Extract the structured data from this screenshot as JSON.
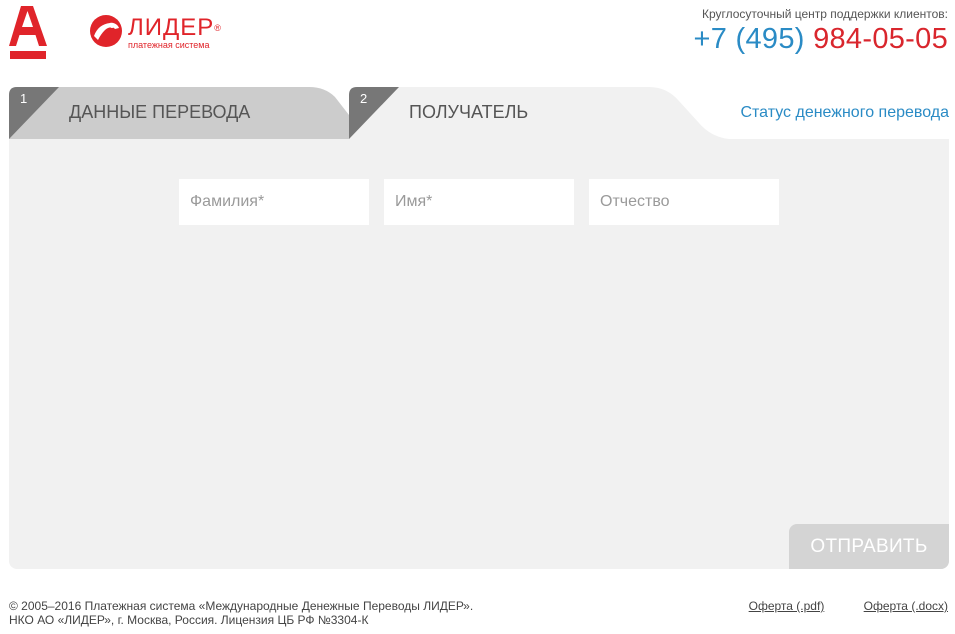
{
  "header": {
    "brand_name": "ЛИДЕР",
    "brand_registered": "®",
    "brand_tagline": "платежная система",
    "support_label": "Круглосуточный центр поддержки клиентов:",
    "phone_code": "+7 (495)",
    "phone_number": "984-05-05"
  },
  "tabs": [
    {
      "number": "1",
      "title": "Данные перевода",
      "active": false
    },
    {
      "number": "2",
      "title": "Получатель",
      "active": true
    }
  ],
  "status_link": "Статус денежного перевода",
  "form": {
    "last_name_placeholder": "Фамилия*",
    "first_name_placeholder": "Имя*",
    "middle_name_placeholder": "Отчество",
    "submit_label": "Отправить"
  },
  "footer": {
    "line1": "© 2005–2016 Платежная система «Международные Денежные Переводы ЛИДЕР».",
    "line2": "НКО АО «ЛИДЕР», г. Москва, Россия. Лицензия ЦБ РФ №3304-К",
    "offer_pdf": "Оферта (.pdf)",
    "offer_docx": "Оферта (.docx)"
  },
  "colors": {
    "brand_red": "#e0242a",
    "link_blue": "#2a8bc5",
    "panel_bg": "#f1f1f1",
    "tab_inactive": "#cccccc",
    "tab_corner": "#777777",
    "submit_disabled": "#d4d4d4"
  },
  "icons": {
    "alfa_logo": "alfa-a-logo-icon",
    "lider_logo": "lider-bear-logo-icon"
  }
}
